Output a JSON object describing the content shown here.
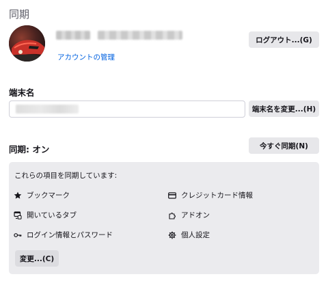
{
  "section_title": "同期",
  "account": {
    "manage_link": "アカウントの管理",
    "logout_button": "ログアウト...(G)"
  },
  "device": {
    "heading": "端末名",
    "change_button": "端末名を変更...(H)"
  },
  "sync": {
    "status": "同期: オン",
    "sync_now_button": "今すぐ同期(N)",
    "panel_intro": "これらの項目を同期しています:",
    "items": [
      {
        "label": "ブックマーク",
        "icon": "star-icon"
      },
      {
        "label": "クレジットカード情報",
        "icon": "credit-card-icon"
      },
      {
        "label": "開いているタブ",
        "icon": "synced-tabs-icon"
      },
      {
        "label": "アドオン",
        "icon": "puzzle-icon"
      },
      {
        "label": "ログイン情報とパスワード",
        "icon": "key-icon"
      },
      {
        "label": "個人設定",
        "icon": "gear-icon"
      }
    ],
    "change_button": "変更...(C)"
  },
  "colors": {
    "link": "#0061e0",
    "button_bg": "#e7e7ea",
    "panel_bg": "#ebebee"
  }
}
